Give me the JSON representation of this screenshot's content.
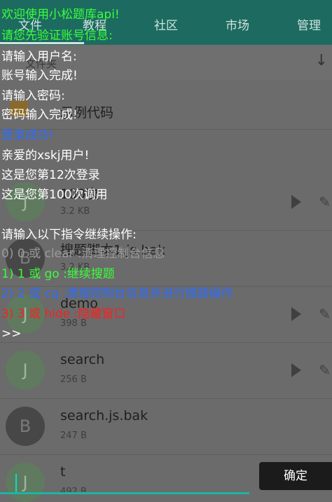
{
  "tabs": [
    "文件",
    "教程",
    "社区",
    "市场",
    "管理"
  ],
  "breadcrumb": "文件夹",
  "files": [
    {
      "name": "示例代码",
      "size": "",
      "type": "folder",
      "avatar": ""
    },
    {
      "name": "100次",
      "size": "3.2 KB",
      "type": "file",
      "avatar": "J"
    },
    {
      "name": "搜题脚本1.js.bak",
      "size": "3.2 KB",
      "type": "file",
      "avatar": "B"
    },
    {
      "name": "demo",
      "size": "398 B",
      "type": "file",
      "avatar": "J"
    },
    {
      "name": "search",
      "size": "256 B",
      "type": "file",
      "avatar": "J"
    },
    {
      "name": "search.js.bak",
      "size": "247 B",
      "type": "file",
      "avatar": "B"
    },
    {
      "name": "t",
      "size": "492 B",
      "type": "file",
      "avatar": "J"
    }
  ],
  "console": {
    "lines": [
      {
        "text": "欢迎使用小松题库api!",
        "color": "#39ff39"
      },
      {
        "text": "请您先验证账号信息:",
        "color": "#39ff39"
      },
      {
        "text": "请输入用户名:",
        "color": "#ffffff"
      },
      {
        "text": "账号输入完成!",
        "color": "#ffffff"
      },
      {
        "text": "请输入密码:",
        "color": "#ffffff"
      },
      {
        "text": "密码输入完成!",
        "color": "#ffffff"
      },
      {
        "text": "登录成功!",
        "color": "#2b6cff"
      },
      {
        "text": "亲爱的xskj用户!",
        "color": "#ffffff"
      },
      {
        "text": "这是您第12次登录",
        "color": "#ffffff"
      },
      {
        "text": "这是您第100次调用",
        "color": "#ffffff"
      },
      {
        "text": "",
        "color": "#ffffff"
      },
      {
        "text": "请输入以下指令继续操作:",
        "color": "#ffffff"
      },
      {
        "text": "0) 0 或 clear :清理控制台信息",
        "color": "#9a9a9a"
      },
      {
        "text": "1) 1 或 go :继续搜题",
        "color": "#39ff39"
      },
      {
        "text": "2) 2 或 cq :清理控制台信息并进行搜题操作",
        "color": "#2b6cff"
      },
      {
        "text": "3) 3 或 hide :隐藏窗口",
        "color": "#ff1e1e"
      },
      {
        "text": ">>",
        "color": "#ffffff"
      }
    ],
    "confirm_label": "确定"
  }
}
